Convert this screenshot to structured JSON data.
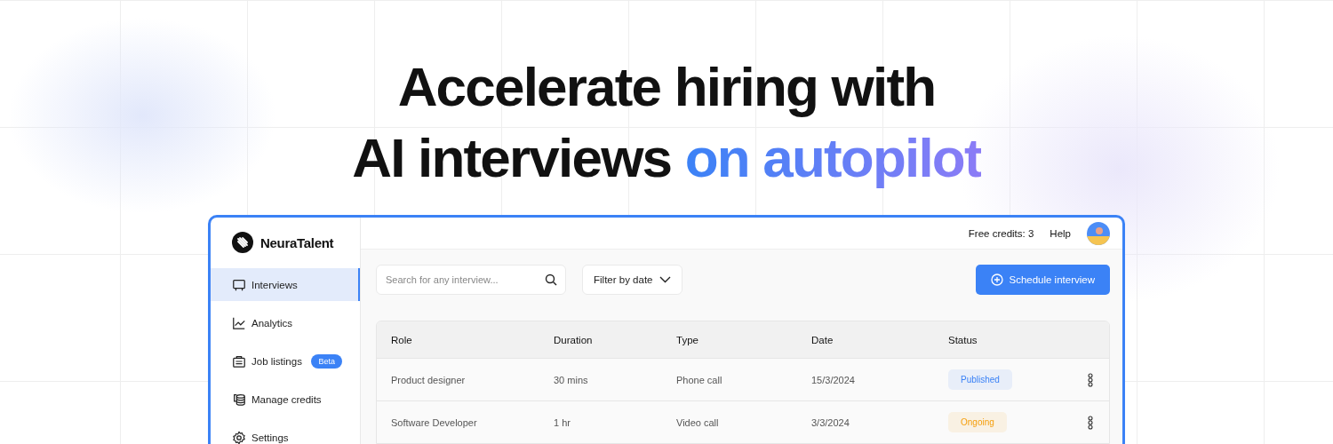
{
  "hero": {
    "line_1": "Accelerate hiring with",
    "line_2": "AI interviews",
    "highlight": "on autopilot"
  },
  "app": {
    "brand": "NeuraTalent",
    "credits": "Free credits: 3",
    "help": "Help",
    "nav": [
      {
        "label": "Interviews",
        "selected": true
      },
      {
        "label": "Analytics",
        "selected": false
      },
      {
        "label": "Job listings",
        "selected": false,
        "badge": "Beta"
      },
      {
        "label": "Manage credits",
        "selected": false
      },
      {
        "label": "Settings",
        "selected": false
      }
    ],
    "search": {
      "placeholder": "Search for any interview..."
    },
    "filter": "Filter by date",
    "schedule": "Schedule interview",
    "table": {
      "columns": [
        "Role",
        "Duration",
        "Type",
        "Date",
        "Status"
      ],
      "rows": [
        {
          "role": "Product designer",
          "duration": "30 mins",
          "type": "Phone call",
          "date": "15/3/2024",
          "status": "Published",
          "color": "#3b82f6"
        },
        {
          "role": "Software Developer",
          "duration": "1 hr",
          "type": "Video call",
          "date": "3/3/2024",
          "status": "Ongoing",
          "color": "#f59e0b"
        }
      ]
    }
  }
}
